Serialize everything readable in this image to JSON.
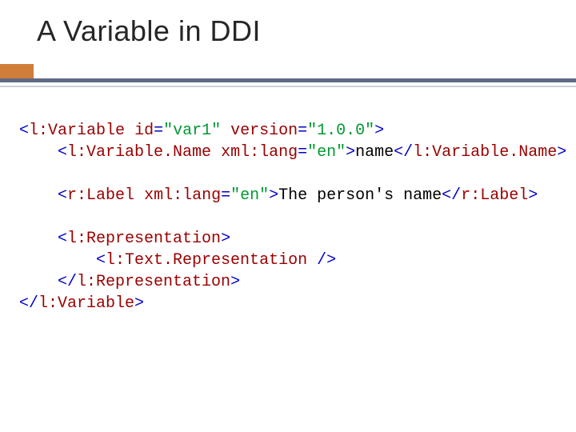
{
  "title": "A Variable in DDI",
  "code": {
    "line1": {
      "open": "<",
      "elem": "l:Variable",
      "sp": " ",
      "attr1": "id",
      "eq1": "=",
      "val1": "\"var1\"",
      "sp2": " ",
      "attr2": "version",
      "eq2": "=",
      "val2": "\"1.0.0\"",
      "close": ">"
    },
    "line2": {
      "indent": "    ",
      "open": "<",
      "elem": "l:Variable.Name",
      "sp": " ",
      "attr1": "xml:lang",
      "eq1": "=",
      "val1": "\"en\"",
      "close1": ">",
      "text": "name",
      "open2": "</",
      "elem2": "l:Variable.Name",
      "close2": ">"
    },
    "line3": {
      "indent": "    ",
      "open": "<",
      "elem": "r:Label",
      "sp": " ",
      "attr1": "xml:lang",
      "eq1": "=",
      "val1": "\"en\"",
      "close1": ">",
      "text": "The person's name",
      "open2": "</",
      "elem2": "r:Label",
      "close2": ">"
    },
    "line4": {
      "indent": "    ",
      "open": "<",
      "elem": "l:Representation",
      "close": ">"
    },
    "line5": {
      "indent": "        ",
      "open": "<",
      "elem": "l:Text.Representation",
      "close": " />"
    },
    "line6": {
      "indent": "    ",
      "open": "</",
      "elem": "l:Representation",
      "close": ">"
    },
    "line7": {
      "open": "</",
      "elem": "l:Variable",
      "close": ">"
    }
  }
}
